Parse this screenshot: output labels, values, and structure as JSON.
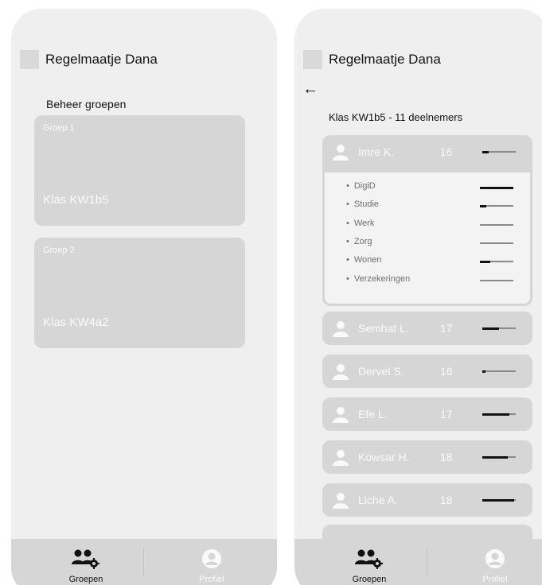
{
  "app_title": "Regelmaatje Dana",
  "groups_screen": {
    "section_title": "Beheer groepen",
    "groups": [
      {
        "label": "Groep 1",
        "name": "Klas KW1b5"
      },
      {
        "label": "Groep 2",
        "name": "Klas KW4a2"
      }
    ]
  },
  "class_screen": {
    "back_icon": "arrow-left-icon",
    "class_title": "Klas KW1b5 - 11 deelnemers",
    "expanded_student": {
      "name": "Imre K.",
      "age": "16",
      "progress": 0.2,
      "categories": [
        {
          "label": "DigiD",
          "progress": 1.0
        },
        {
          "label": "Studie",
          "progress": 0.2
        },
        {
          "label": "Werk",
          "progress": 0.0
        },
        {
          "label": "Zorg",
          "progress": 0.0
        },
        {
          "label": "Wonen",
          "progress": 0.3
        },
        {
          "label": "Verzekeringen",
          "progress": 0.0
        }
      ]
    },
    "students": [
      {
        "name": "Semhat L.",
        "age": "17",
        "progress": 0.5
      },
      {
        "name": "Dervel S.",
        "age": "16",
        "progress": 0.1
      },
      {
        "name": "Efe L.",
        "age": "17",
        "progress": 0.8
      },
      {
        "name": "Kowsar H.",
        "age": "18",
        "progress": 0.75
      },
      {
        "name": "Liche A.",
        "age": "18",
        "progress": 0.95
      }
    ]
  },
  "tabbar": {
    "tabs": [
      {
        "label": "Groepen",
        "icon": "users-gear-icon",
        "active": true
      },
      {
        "label": "Profiel",
        "icon": "profile-icon",
        "active": false
      }
    ]
  },
  "colors": {
    "card": "#d6d6d6",
    "screen": "#efefef",
    "bar_fill": "#111111",
    "bar_track": "#8a8a8a"
  }
}
